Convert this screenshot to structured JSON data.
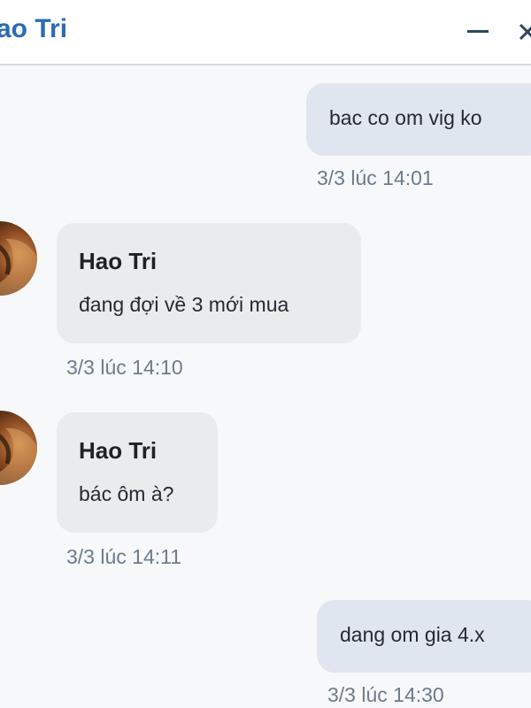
{
  "header": {
    "title": "ao Tri",
    "minimize_icon": "minimize-icon",
    "close_icon": "close-icon"
  },
  "contact": {
    "name": "Hao Tri"
  },
  "messages": [
    {
      "direction": "outgoing",
      "text": "bac co om vig ko",
      "time": "3/3 lúc 14:01"
    },
    {
      "direction": "incoming",
      "sender": "Hao Tri",
      "text": "đang đợi về 3 mới mua",
      "time": "3/3 lúc 14:10"
    },
    {
      "direction": "incoming",
      "sender": "Hao Tri",
      "text": "bác ôm à?",
      "time": "3/3 lúc 14:11"
    },
    {
      "direction": "outgoing",
      "text": "dang om gia 4.x",
      "time": "3/3 lúc 14:30"
    }
  ],
  "colors": {
    "accent": "#2a6bb5",
    "outgoing_bubble": "#dfe6ef",
    "incoming_bubble": "#eaebed",
    "timestamp": "#6c7c8d"
  }
}
